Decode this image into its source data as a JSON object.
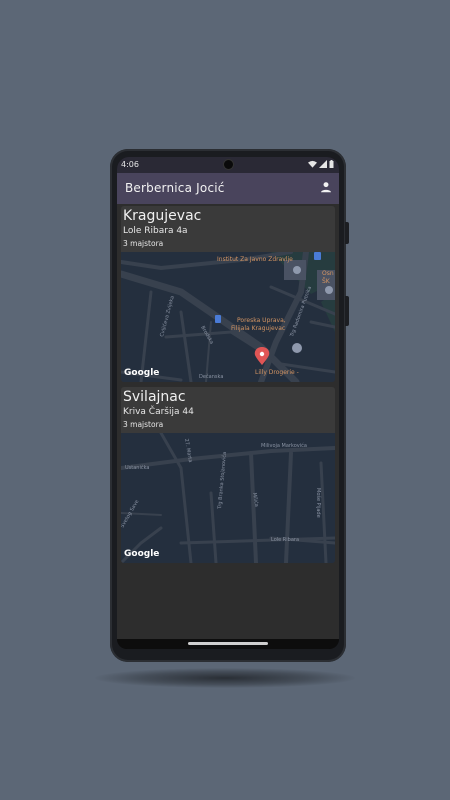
{
  "status_bar": {
    "time": "4:06"
  },
  "app_bar": {
    "title": "Berbernica Jocić",
    "account_icon": "account-icon"
  },
  "colors": {
    "background": "#5c6776",
    "app_bar": "#49445c",
    "card": "#3a3a3a",
    "map": "#242f3e",
    "poi_label": "#d59563",
    "marker": "#e05555"
  },
  "cards": [
    {
      "city": "Kragujevac",
      "address": "Lole Ribara 4a",
      "count": "3 majstora",
      "map": {
        "attribution": "Google",
        "labels": {
          "poi_institut": "Institut Za Javno Zdravlje",
          "poi_poreska_1": "Poreska Uprava,",
          "poi_poreska_2": "Filijala Kragujevac",
          "poi_lily": "Lilly Drogerie -",
          "poi_edge_1": "Osn",
          "poi_edge_2": "ŠK",
          "street_1": "Cvijićeva Zvijeka",
          "street_2": "Brodska",
          "street_3": "Dečanska",
          "street_4": "Trg Radomira Putnika"
        }
      }
    },
    {
      "city": "Svilajnac",
      "address": "Kriva Čaršija 44",
      "count": "3 majstora",
      "map": {
        "attribution": "Google",
        "labels": {
          "street_1": "Milivoja Markovića",
          "street_2": "Ustanička",
          "street_3": "27. Marta",
          "street_4": "Trg Branka Stojanovića",
          "street_5": "Lole Ribara",
          "street_6": "Moše Pijade",
          "street_7": "Svetog Save",
          "street_8": "Milića"
        }
      }
    }
  ]
}
